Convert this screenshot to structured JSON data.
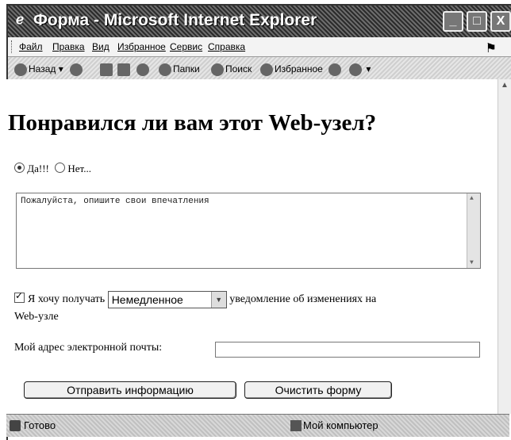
{
  "window": {
    "title": "Форма - Microsoft Internet Explorer",
    "controls": {
      "minimize": "_",
      "maximize": "□",
      "close": "X"
    }
  },
  "menu": {
    "items": [
      "Файл",
      "Правка",
      "Вид",
      "Избранное",
      "Сервис",
      "Справка"
    ]
  },
  "toolbar": {
    "back": "Назад",
    "folders": "Папки",
    "search": "Поиск",
    "favorites": "Избранное"
  },
  "page": {
    "heading": "Понравился ли вам этот Web-узел?",
    "radio_yes": "Да!!!",
    "radio_no": "Нет...",
    "radio_selected": "yes",
    "textarea_value": "Пожалуйста, опишите свои впечатления",
    "checkbox_label": "Я хочу получать",
    "checkbox_checked": true,
    "select_value": "Немедленное",
    "after_select": "уведомление об изменениях на",
    "line2": "Web-узле",
    "email_label": "Мой адрес электронной почты:",
    "email_value": "",
    "submit_label": "Отправить информацию",
    "reset_label": "Очистить форму"
  },
  "status": {
    "text": "Готово",
    "zone": "Мой компьютер"
  }
}
